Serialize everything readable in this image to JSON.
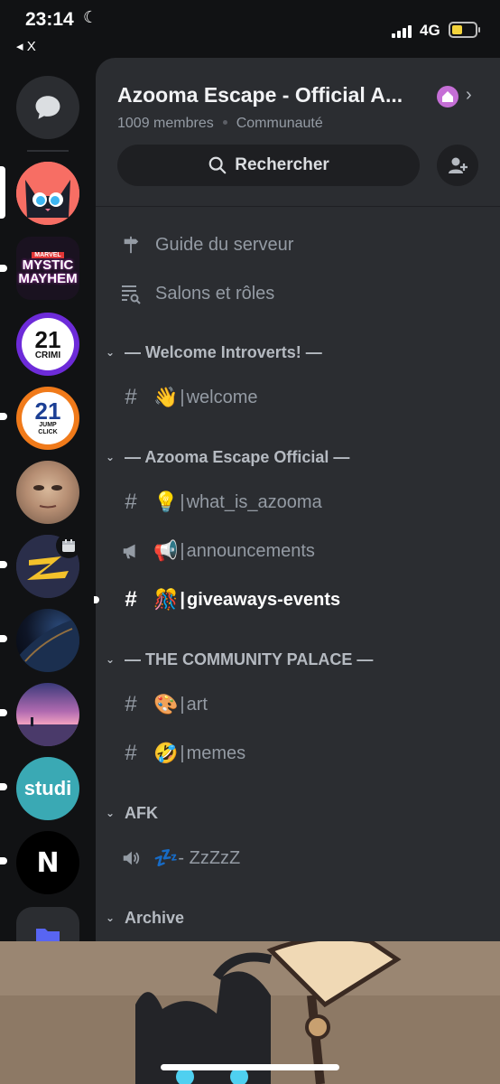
{
  "status": {
    "time": "23:14",
    "back_label": "X",
    "network": "4G",
    "battery_level": 0.35
  },
  "server": {
    "title": "Azooma Escape - Official A...",
    "members": "1009 membres",
    "type": "Communauté",
    "search_label": "Rechercher"
  },
  "rail": {
    "servers": [
      {
        "name": "Cat server",
        "selected": true
      },
      {
        "name": "Mystic Mayhem",
        "text": "MYSTIC MAYHEM",
        "label_top": "MARVEL"
      },
      {
        "name": "21 Crimi",
        "text": "21",
        "sub": "CRIMI"
      },
      {
        "name": "21 Jump Click",
        "text": "21",
        "sub": "JUMP CLICK"
      },
      {
        "name": "Face server"
      },
      {
        "name": "Z server"
      },
      {
        "name": "Earth server"
      },
      {
        "name": "Sunset server"
      },
      {
        "name": "Studi",
        "text": "studi"
      },
      {
        "name": "N server",
        "text": "N"
      }
    ]
  },
  "menu": {
    "guide": "Guide du serveur",
    "roles": "Salons et rôles"
  },
  "categories": [
    {
      "label": "— Welcome Introverts! —",
      "channels": [
        {
          "icon": "hash",
          "emoji": "👋",
          "name": "welcome"
        }
      ]
    },
    {
      "label": "— Azooma Escape Official —",
      "channels": [
        {
          "icon": "hash",
          "emoji": "💡",
          "name": "what_is_azooma"
        },
        {
          "icon": "megaphone",
          "emoji": "📢",
          "name": "announcements"
        },
        {
          "icon": "hash",
          "emoji": "🎊",
          "name": "giveaways-events",
          "active": true
        }
      ]
    },
    {
      "label": "— THE COMMUNITY PALACE —",
      "channels": [
        {
          "icon": "hash",
          "emoji": "🎨",
          "name": "art"
        },
        {
          "icon": "hash",
          "emoji": "🤣",
          "name": "memes"
        }
      ]
    },
    {
      "label": "AFK",
      "channels": [
        {
          "icon": "speaker",
          "emoji": "💤",
          "name": "- ZzZzZ"
        }
      ]
    },
    {
      "label": "Archive",
      "channels": []
    }
  ],
  "colors": {
    "bg": "#111214",
    "panel": "#2b2d31",
    "input": "#1e1f22",
    "muted": "#949ba4",
    "accent": "#f3d33b"
  }
}
